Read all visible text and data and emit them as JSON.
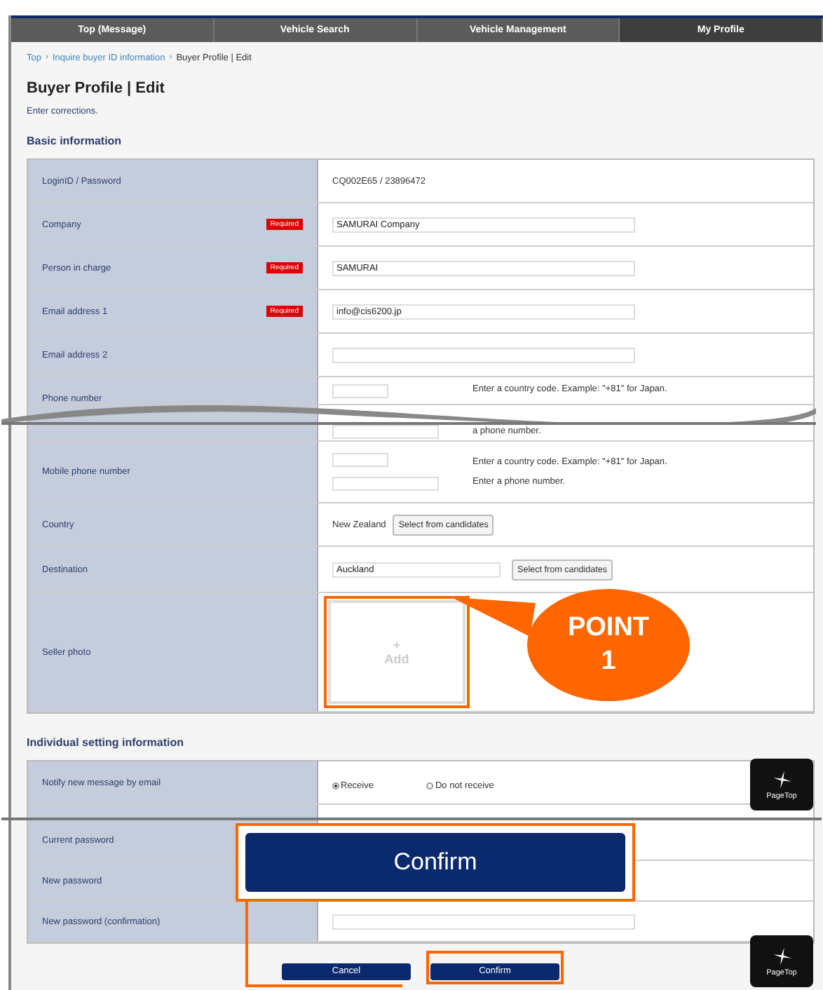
{
  "nav": {
    "tabs": [
      {
        "label": "Top (Message)",
        "selected": false
      },
      {
        "label": "Vehicle Search",
        "selected": false
      },
      {
        "label": "Vehicle Management",
        "selected": false
      },
      {
        "label": "My Profile",
        "selected": true
      }
    ]
  },
  "breadcrumb_separator": "›",
  "breadcrumb": [
    {
      "label": "Top",
      "kind": "link"
    },
    {
      "label": "Inquire buyer ID information",
      "kind": "link"
    },
    {
      "label": "Buyer Profile | Edit",
      "kind": "current"
    }
  ],
  "title": "Buyer Profile | Edit",
  "instruction": "Enter corrections.",
  "sections": [
    {
      "heading": "Basic information",
      "rows": [
        {
          "kind": "text",
          "label": "LoginID / Password",
          "value": "CQ002E65 / 23896472"
        },
        {
          "kind": "input",
          "label": "Company",
          "badge": "Required",
          "value": "SAMURAI Company"
        },
        {
          "kind": "input",
          "label": "Person in charge",
          "badge": "Required",
          "value": "SAMURAI"
        },
        {
          "kind": "input",
          "label": "Email address 1",
          "badge": "Required",
          "value": "info@cis6200.jp"
        },
        {
          "kind": "input",
          "label": "Email address 2"
        },
        {
          "kind": "phone_top",
          "label": "Phone number",
          "note": "Enter a country code. Example: \"+81\" for Japan."
        },
        {
          "kind": "break"
        },
        {
          "kind": "phone_bottom",
          "note": "a phone number."
        },
        {
          "kind": "phone",
          "label": "Mobile phone number",
          "notes": [
            "Enter a country code. Example: \"+81\" for Japan.",
            "Enter a phone number."
          ]
        },
        {
          "kind": "select_text",
          "label": "Country",
          "value": "New Zealand",
          "button": "Select from candidates"
        },
        {
          "kind": "select_input",
          "label": "Destination",
          "value": "Auckland",
          "button": "Select from candidates"
        },
        {
          "kind": "photo",
          "label": "Seller photo",
          "icon": "+",
          "button": "Add",
          "highlighted": true
        }
      ]
    },
    {
      "heading": "Individual setting information",
      "rows": [
        {
          "kind": "radio",
          "label": "Notify new message by email",
          "options": [
            {
              "label": "Receive",
              "selected": true
            },
            {
              "label": "Do not receive",
              "selected": false
            }
          ]
        },
        {
          "kind": "sliver"
        },
        {
          "kind": "cut"
        },
        {
          "kind": "covered",
          "label": "Current password"
        },
        {
          "kind": "covered",
          "label": "New password"
        },
        {
          "kind": "password",
          "label": "New password (confirmation)"
        }
      ]
    }
  ],
  "buttons": [
    {
      "label": "Cancel",
      "highlighted": false
    },
    {
      "label": "Confirm",
      "highlighted": true
    }
  ],
  "callouts": [
    {
      "kind": "point",
      "title": "POINT",
      "number": "1"
    },
    {
      "kind": "zoom",
      "label": "Confirm"
    }
  ],
  "page_top": [
    "PageTop",
    "PageTop"
  ]
}
